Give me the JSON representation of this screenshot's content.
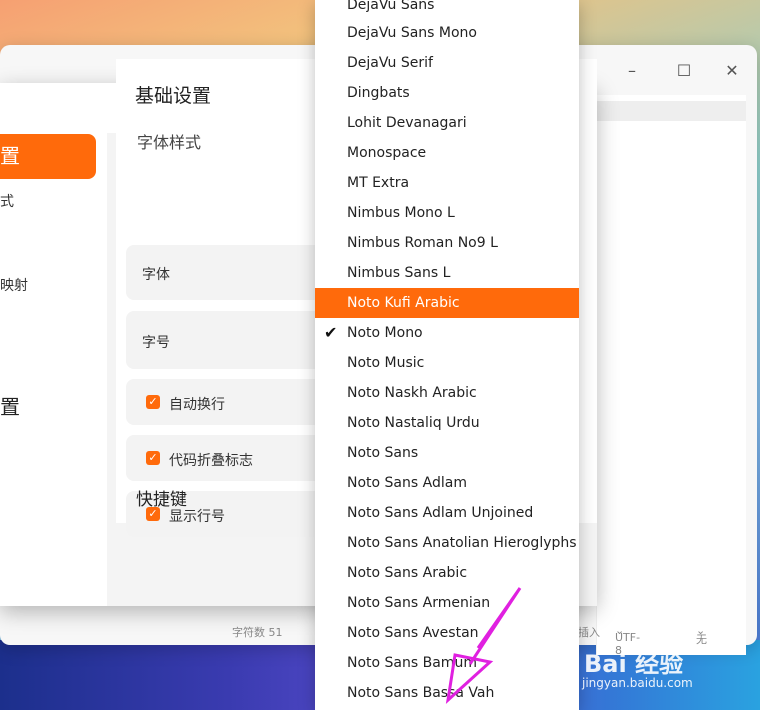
{
  "editor": {
    "status_chars": "字符数 51",
    "status_insert": "插入",
    "status_encoding": "UTF-8",
    "status_highlight": "无"
  },
  "dialog": {
    "nav_active_label": "置",
    "nav_item_1": "式",
    "nav_item_2": "映射",
    "nav_section_2": "置",
    "title": "基础设置",
    "section_font_style": "字体样式",
    "font_label": "字体",
    "size_label": "字号",
    "word_wrap_label": "自动换行",
    "code_fold_label": "代码折叠标志",
    "line_numbers_label": "显示行号",
    "shortcuts_title": "快捷键"
  },
  "dropdown": {
    "options": [
      "DejaVu Sans",
      "DejaVu Sans Mono",
      "DejaVu Serif",
      "Dingbats",
      "Lohit Devanagari",
      "Monospace",
      "MT Extra",
      "Nimbus Mono L",
      "Nimbus Roman No9 L",
      "Nimbus Sans L",
      "Noto Kufi Arabic",
      "Noto Mono",
      "Noto Music",
      "Noto Naskh Arabic",
      "Noto Nastaliq Urdu",
      "Noto Sans",
      "Noto Sans Adlam",
      "Noto Sans Adlam Unjoined",
      "Noto Sans Anatolian Hieroglyphs",
      "Noto Sans Arabic",
      "Noto Sans Armenian",
      "Noto Sans Avestan",
      "Noto Sans Bamum",
      "Noto Sans Bassa Vah"
    ],
    "highlighted": "Noto Kufi Arabic",
    "checked": "Noto Mono"
  },
  "watermark": {
    "brand": "Bai  经验",
    "url": "jingyan.baidu.com"
  },
  "colors": {
    "accent": "#ff6a0b",
    "annotation": "#e020e0"
  }
}
